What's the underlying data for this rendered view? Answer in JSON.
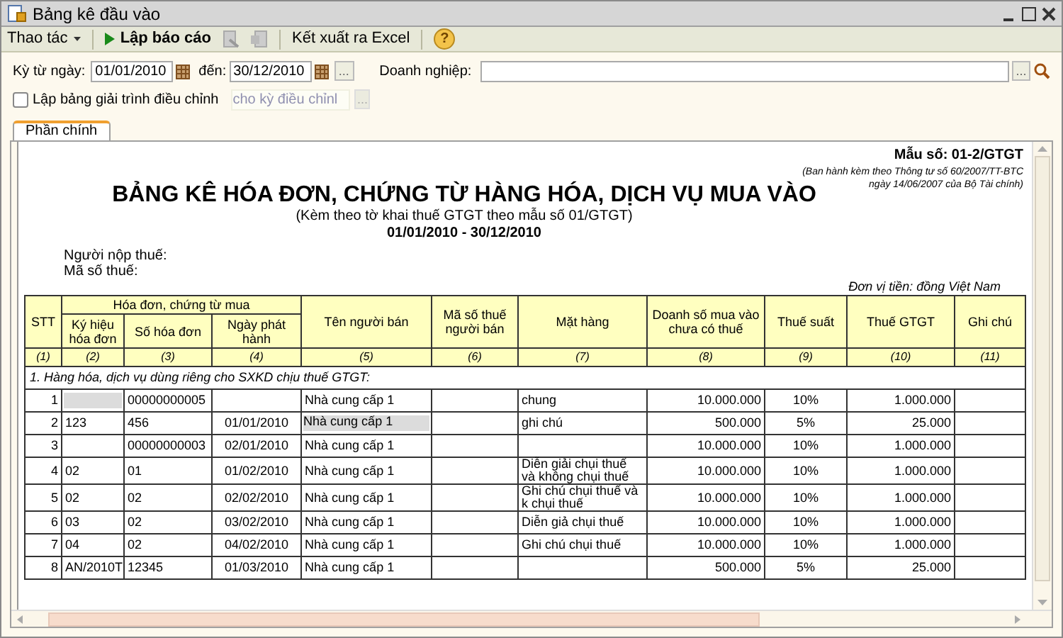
{
  "window": {
    "title": "Bảng kê đầu vào"
  },
  "toolbar": {
    "menu": "Thao tác",
    "run": "Lập báo cáo",
    "export": "Kết xuất ra Excel",
    "help": "?"
  },
  "filters": {
    "from_label": "Kỳ từ ngày:",
    "from": "01/01/2010",
    "to_label": "đến:",
    "to": "30/12/2010",
    "browse": "...",
    "company_label": "Doanh nghiệp:",
    "company_browse": "...",
    "adjust_label": "Lập bảng giải trình điều chỉnh",
    "adjust_checked": false,
    "period_placeholder": "cho kỳ điều chỉnl",
    "period_browse": "..."
  },
  "tabs": [
    {
      "label": "Phần chính",
      "selected": true
    }
  ],
  "report": {
    "form_no": "Mẫu số: 01-2/GTGT",
    "issued_line1": "(Ban hành kèm theo Thông tư số 60/2007/TT-BTC",
    "issued_line2": "ngày 14/06/2007 của Bộ Tài chính)",
    "title": "BẢNG KÊ HÓA ĐƠN, CHỨNG TỪ HÀNG HÓA, DỊCH VỤ MUA VÀO",
    "subtitle": "(Kèm theo tờ khai thuế GTGT theo mẫu số 01/GTGT)",
    "period": "01/01/2010 - 30/12/2010",
    "taxpayer_label": "Người nộp thuế:",
    "tax_code_label": "Mã số thuế:",
    "currency": "Đơn vị tiền: đồng Việt Nam",
    "group_header": "Hóa đơn, chứng từ mua",
    "columns": [
      "STT",
      "Ký hiệu hóa đơn",
      "Số hóa đơn",
      "Ngày phát hành",
      "Tên người bán",
      "Mã số thuế người bán",
      "Mặt hàng",
      "Doanh số mua vào chưa có thuế",
      "Thuế suất",
      "Thuế GTGT",
      "Ghi chú"
    ],
    "column_numbers": [
      "(1)",
      "(2)",
      "(3)",
      "(4)",
      "(5)",
      "(6)",
      "(7)",
      "(8)",
      "(9)",
      "(10)",
      "(11)"
    ],
    "section": "1. Hàng hóa, dịch vụ dùng riêng cho SXKD chịu thuế GTGT:",
    "rows": [
      {
        "stt": "1",
        "number": "00000000005",
        "seller": "Nhà cung cấp 1",
        "item": "chung",
        "amount": "10.000.000",
        "rate": "10%",
        "vat": "1.000.000",
        "symbol_shaded": true,
        "seller_shaded": false
      },
      {
        "stt": "2",
        "symbol": "123",
        "number": "456",
        "date": "01/01/2010",
        "seller": "Nhà cung cấp 1",
        "item": "ghi chú",
        "amount": "500.000",
        "rate": "5%",
        "vat": "25.000",
        "symbol_shaded": false,
        "seller_shaded": true
      },
      {
        "stt": "3",
        "number": "00000000003",
        "date": "02/01/2010",
        "seller": "Nhà cung cấp 1",
        "amount": "10.000.000",
        "rate": "10%",
        "vat": "1.000.000",
        "symbol_shaded": false,
        "seller_shaded": false
      },
      {
        "stt": "4",
        "symbol": "02",
        "number": "01",
        "date": "01/02/2010",
        "seller": "Nhà cung cấp 1",
        "item": "Diễn giải chụi thuế và không chụi thuế",
        "amount": "10.000.000",
        "rate": "10%",
        "vat": "1.000.000",
        "symbol_shaded": false,
        "seller_shaded": false
      },
      {
        "stt": "5",
        "symbol": "02",
        "number": "02",
        "date": "02/02/2010",
        "seller": "Nhà cung cấp 1",
        "item": "Ghi chú chụi thuế và k chụi thuế",
        "amount": "10.000.000",
        "rate": "10%",
        "vat": "1.000.000",
        "symbol_shaded": false,
        "seller_shaded": false
      },
      {
        "stt": "6",
        "symbol": "03",
        "number": "02",
        "date": "03/02/2010",
        "seller": "Nhà cung cấp 1",
        "item": "Diễn giả chụi thuế",
        "amount": "10.000.000",
        "rate": "10%",
        "vat": "1.000.000",
        "symbol_shaded": false,
        "seller_shaded": false
      },
      {
        "stt": "7",
        "symbol": "04",
        "number": "02",
        "date": "04/02/2010",
        "seller": "Nhà cung cấp 1",
        "item": "Ghi chú chụi thuế",
        "amount": "10.000.000",
        "rate": "10%",
        "vat": "1.000.000",
        "symbol_shaded": false,
        "seller_shaded": false
      },
      {
        "stt": "8",
        "symbol": "AN/2010T",
        "number": "12345",
        "date": "01/03/2010",
        "seller": "Nhà cung cấp 1",
        "amount": "500.000",
        "rate": "5%",
        "vat": "25.000",
        "symbol_shaded": false,
        "seller_shaded": false
      }
    ]
  }
}
